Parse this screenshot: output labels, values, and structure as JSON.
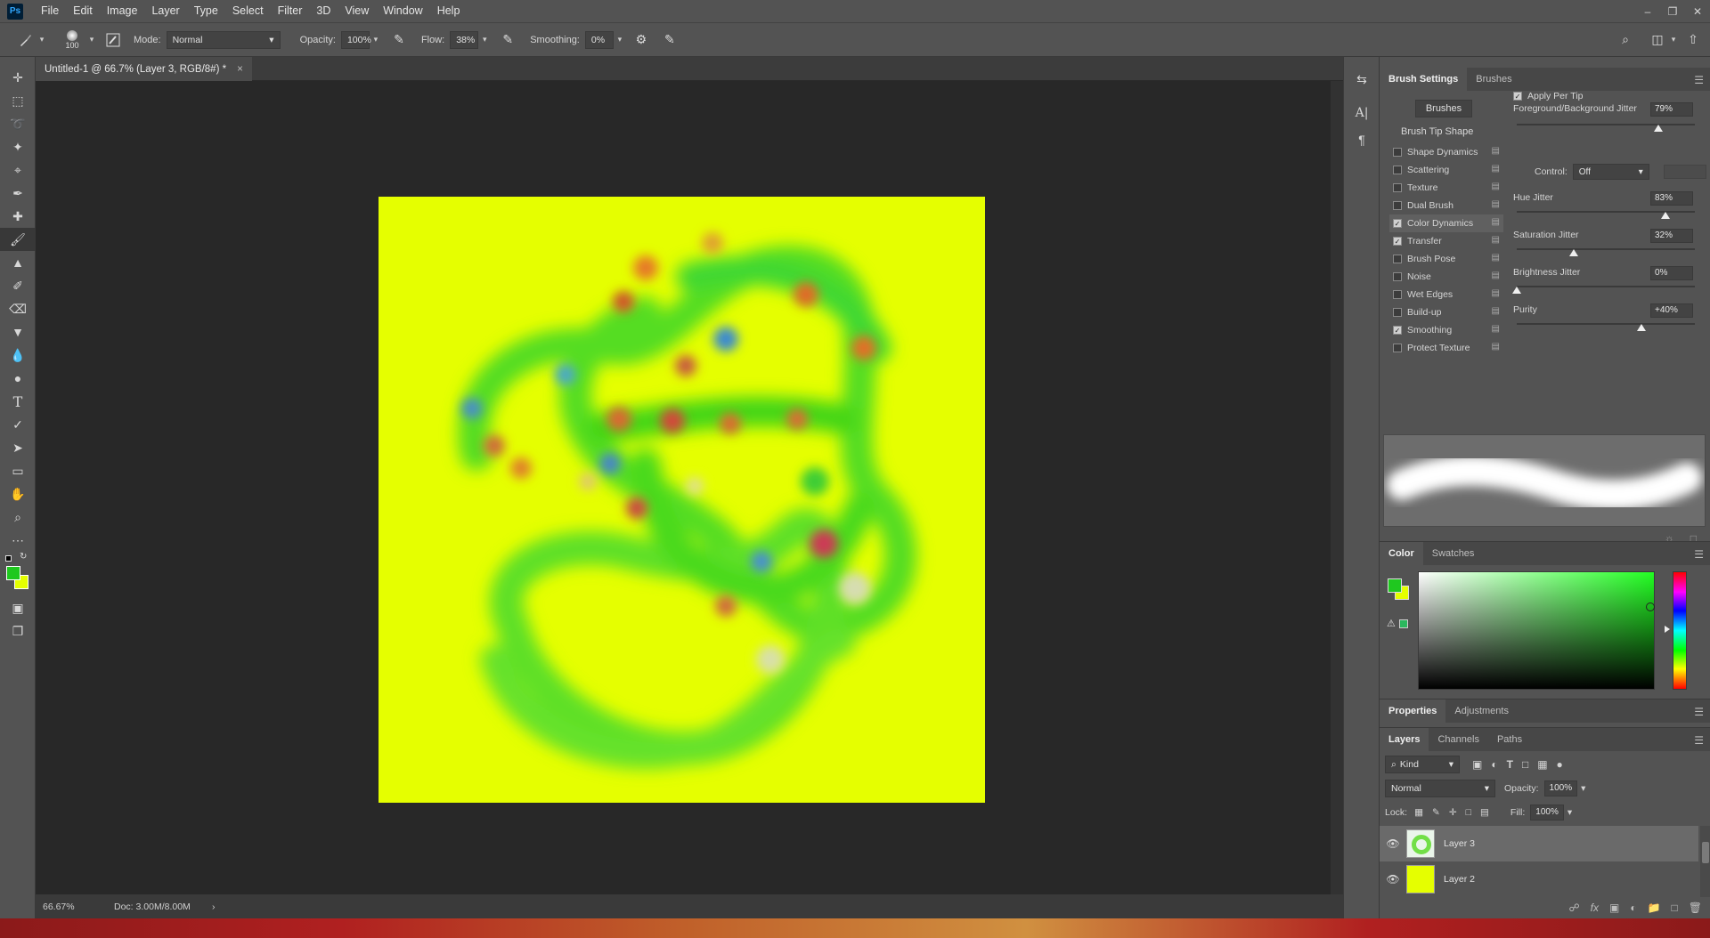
{
  "menubar": {
    "logo": "Ps",
    "items": [
      "File",
      "Edit",
      "Image",
      "Layer",
      "Type",
      "Select",
      "Filter",
      "3D",
      "View",
      "Window",
      "Help"
    ]
  },
  "optionsbar": {
    "brush_size": "100",
    "mode_label": "Mode:",
    "mode_value": "Normal",
    "opacity_label": "Opacity:",
    "opacity_value": "100%",
    "flow_label": "Flow:",
    "flow_value": "38%",
    "smoothing_label": "Smoothing:",
    "smoothing_value": "0%"
  },
  "document": {
    "tab_title": "Untitled-1 @ 66.7% (Layer 3, RGB/8#) *",
    "close_glyph": "×",
    "canvas_color": "#e5ff00",
    "zoom": "66.67%",
    "doc_size": "Doc: 3.00M/8.00M"
  },
  "brush_settings": {
    "tabs": [
      "Brush Settings",
      "Brushes"
    ],
    "brushes_button": "Brushes",
    "tip_shape": "Brush Tip Shape",
    "apply_per_tip": "Apply Per Tip",
    "options": [
      {
        "label": "Shape Dynamics",
        "checked": false
      },
      {
        "label": "Scattering",
        "checked": false
      },
      {
        "label": "Texture",
        "checked": false
      },
      {
        "label": "Dual Brush",
        "checked": false
      },
      {
        "label": "Color Dynamics",
        "checked": true
      },
      {
        "label": "Transfer",
        "checked": true
      },
      {
        "label": "Brush Pose",
        "checked": false
      },
      {
        "label": "Noise",
        "checked": false
      },
      {
        "label": "Wet Edges",
        "checked": false
      },
      {
        "label": "Build-up",
        "checked": false
      },
      {
        "label": "Smoothing",
        "checked": true
      },
      {
        "label": "Protect Texture",
        "checked": false
      }
    ],
    "fg_bg_jitter": {
      "label": "Foreground/Background Jitter",
      "value": "79%",
      "fraction": 0.79
    },
    "control": {
      "label": "Control:",
      "value": "Off"
    },
    "hue_jitter": {
      "label": "Hue Jitter",
      "value": "83%",
      "fraction": 0.83
    },
    "saturation_jitter": {
      "label": "Saturation Jitter",
      "value": "32%",
      "fraction": 0.32
    },
    "brightness_jitter": {
      "label": "Brightness Jitter",
      "value": "0%",
      "fraction": 0.0
    },
    "purity": {
      "label": "Purity",
      "value": "+40%",
      "fraction": 0.7
    }
  },
  "color_panel": {
    "tabs": [
      "Color",
      "Swatches"
    ],
    "foreground": "#1fc81f",
    "background": "#e5ff00"
  },
  "properties_panel": {
    "tabs": [
      "Properties",
      "Adjustments"
    ]
  },
  "layers_panel": {
    "tabs": [
      "Layers",
      "Channels",
      "Paths"
    ],
    "filter_label": "Kind",
    "blend_mode": "Normal",
    "opacity_label": "Opacity:",
    "opacity_value": "100%",
    "lock_label": "Lock:",
    "fill_label": "Fill:",
    "fill_value": "100%",
    "layers": [
      {
        "name": "Layer 3",
        "selected": true
      },
      {
        "name": "Layer 2",
        "selected": false
      }
    ]
  }
}
